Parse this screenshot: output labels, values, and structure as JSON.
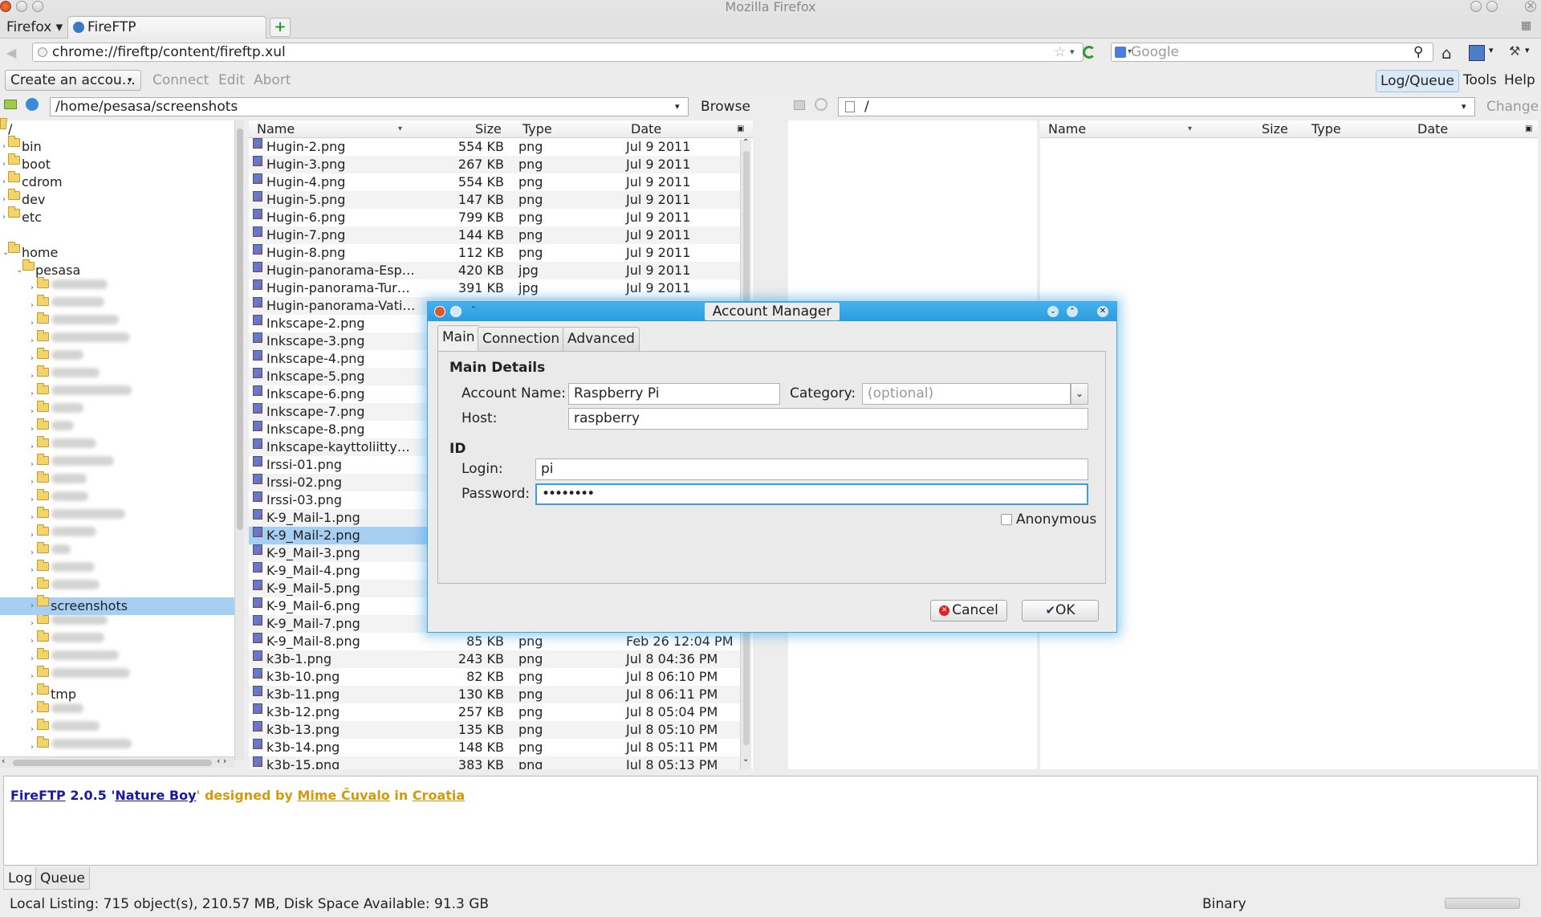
{
  "window": {
    "title": "Mozilla Firefox"
  },
  "browser": {
    "menu_label": "Firefox",
    "tab_label": "FireFTP",
    "url": "chrome://fireftp/content/fireftp.xul",
    "search_placeholder": "Google"
  },
  "toolbar": {
    "account_select": "Create an accou…",
    "connect": "Connect",
    "edit": "Edit",
    "abort": "Abort",
    "log_queue": "Log/Queue",
    "tools": "Tools",
    "help": "Help"
  },
  "local": {
    "path": "/home/pesasa/screenshots",
    "browse": "Browse",
    "tree": {
      "root": "/",
      "top_items": [
        "bin",
        "boot",
        "cdrom",
        "dev",
        "etc",
        "home"
      ],
      "user": "pesasa",
      "selected": "screenshots",
      "tmp": "tmp"
    },
    "columns": {
      "name": "Name",
      "size": "Size",
      "type": "Type",
      "date": "Date"
    },
    "files": [
      {
        "name": "Hugin-2.png",
        "size": "554 KB",
        "type": "png",
        "date": "Jul 9 2011"
      },
      {
        "name": "Hugin-3.png",
        "size": "267 KB",
        "type": "png",
        "date": "Jul 9 2011"
      },
      {
        "name": "Hugin-4.png",
        "size": "554 KB",
        "type": "png",
        "date": "Jul 9 2011"
      },
      {
        "name": "Hugin-5.png",
        "size": "147 KB",
        "type": "png",
        "date": "Jul 9 2011"
      },
      {
        "name": "Hugin-6.png",
        "size": "799 KB",
        "type": "png",
        "date": "Jul 9 2011"
      },
      {
        "name": "Hugin-7.png",
        "size": "144 KB",
        "type": "png",
        "date": "Jul 9 2011"
      },
      {
        "name": "Hugin-8.png",
        "size": "112 KB",
        "type": "png",
        "date": "Jul 9 2011"
      },
      {
        "name": "Hugin-panorama-Esp…",
        "size": "420 KB",
        "type": "jpg",
        "date": "Jul 9 2011"
      },
      {
        "name": "Hugin-panorama-Tur…",
        "size": "391 KB",
        "type": "jpg",
        "date": "Jul 9 2011"
      },
      {
        "name": "Hugin-panorama-Vati…",
        "size": "",
        "type": "",
        "date": ""
      },
      {
        "name": "Inkscape-2.png",
        "size": "",
        "type": "",
        "date": ""
      },
      {
        "name": "Inkscape-3.png",
        "size": "",
        "type": "",
        "date": ""
      },
      {
        "name": "Inkscape-4.png",
        "size": "",
        "type": "",
        "date": ""
      },
      {
        "name": "Inkscape-5.png",
        "size": "",
        "type": "",
        "date": ""
      },
      {
        "name": "Inkscape-6.png",
        "size": "",
        "type": "",
        "date": ""
      },
      {
        "name": "Inkscape-7.png",
        "size": "",
        "type": "",
        "date": ""
      },
      {
        "name": "Inkscape-8.png",
        "size": "",
        "type": "",
        "date": ""
      },
      {
        "name": "Inkscape-kayttoliitty…",
        "size": "",
        "type": "",
        "date": ""
      },
      {
        "name": "Irssi-01.png",
        "size": "",
        "type": "",
        "date": ""
      },
      {
        "name": "Irssi-02.png",
        "size": "",
        "type": "",
        "date": ""
      },
      {
        "name": "Irssi-03.png",
        "size": "",
        "type": "",
        "date": ""
      },
      {
        "name": "K-9_Mail-1.png",
        "size": "",
        "type": "",
        "date": ""
      },
      {
        "name": "K-9_Mail-2.png",
        "size": "",
        "type": "",
        "date": ""
      },
      {
        "name": "K-9_Mail-3.png",
        "size": "",
        "type": "",
        "date": ""
      },
      {
        "name": "K-9_Mail-4.png",
        "size": "",
        "type": "",
        "date": ""
      },
      {
        "name": "K-9_Mail-5.png",
        "size": "",
        "type": "",
        "date": ""
      },
      {
        "name": "K-9_Mail-6.png",
        "size": "",
        "type": "",
        "date": ""
      },
      {
        "name": "K-9_Mail-7.png",
        "size": "",
        "type": "",
        "date": ""
      },
      {
        "name": "K-9_Mail-8.png",
        "size": "85 KB",
        "type": "png",
        "date": "Feb 26 12:04 PM"
      },
      {
        "name": "k3b-1.png",
        "size": "243 KB",
        "type": "png",
        "date": "Jul 8 04:36 PM"
      },
      {
        "name": "k3b-10.png",
        "size": "82 KB",
        "type": "png",
        "date": "Jul 8 06:10 PM"
      },
      {
        "name": "k3b-11.png",
        "size": "130 KB",
        "type": "png",
        "date": "Jul 8 06:11 PM"
      },
      {
        "name": "k3b-12.png",
        "size": "257 KB",
        "type": "png",
        "date": "Jul 8 05:04 PM"
      },
      {
        "name": "k3b-13.png",
        "size": "135 KB",
        "type": "png",
        "date": "Jul 8 05:10 PM"
      },
      {
        "name": "k3b-14.png",
        "size": "148 KB",
        "type": "png",
        "date": "Jul 8 05:11 PM"
      },
      {
        "name": "k3b-15.png",
        "size": "383 KB",
        "type": "png",
        "date": "Jul 8 05:13 PM"
      }
    ],
    "selected_file": "K-9_Mail-2.png"
  },
  "remote": {
    "path": "/",
    "change": "Change",
    "columns": {
      "name": "Name",
      "size": "Size",
      "type": "Type",
      "date": "Date"
    }
  },
  "dialog": {
    "title": "Account Manager",
    "tabs": [
      "Main",
      "Connection",
      "Advanced"
    ],
    "section_main": "Main Details",
    "account_name_label": "Account Name:",
    "account_name": "Raspberry Pi",
    "category_label": "Category:",
    "category_placeholder": "(optional)",
    "host_label": "Host:",
    "host": "raspberry",
    "section_id": "ID",
    "login_label": "Login:",
    "login": "pi",
    "password_label": "Password:",
    "password": "••••••••",
    "anonymous_label": "Anonymous",
    "cancel": "Cancel",
    "ok": "OK"
  },
  "log": {
    "app": "FireFTP",
    "version": "2.0.5 '",
    "codename": "Nature Boy",
    "designed_by": "' designed by ",
    "designer": "Mime Čuvalo",
    "in": " in ",
    "country": "Croatia"
  },
  "bottom_tabs": [
    "Log",
    "Queue"
  ],
  "status": {
    "local_listing": "Local Listing: 715 object(s), 210.57 MB, Disk Space Available: 91.3 GB",
    "mode": "Binary"
  },
  "colors": {
    "selection": "#a6cff2",
    "dialog_accent": "#2b9ce0",
    "link": "#1a1a9e",
    "orange": "#d59a0b"
  }
}
